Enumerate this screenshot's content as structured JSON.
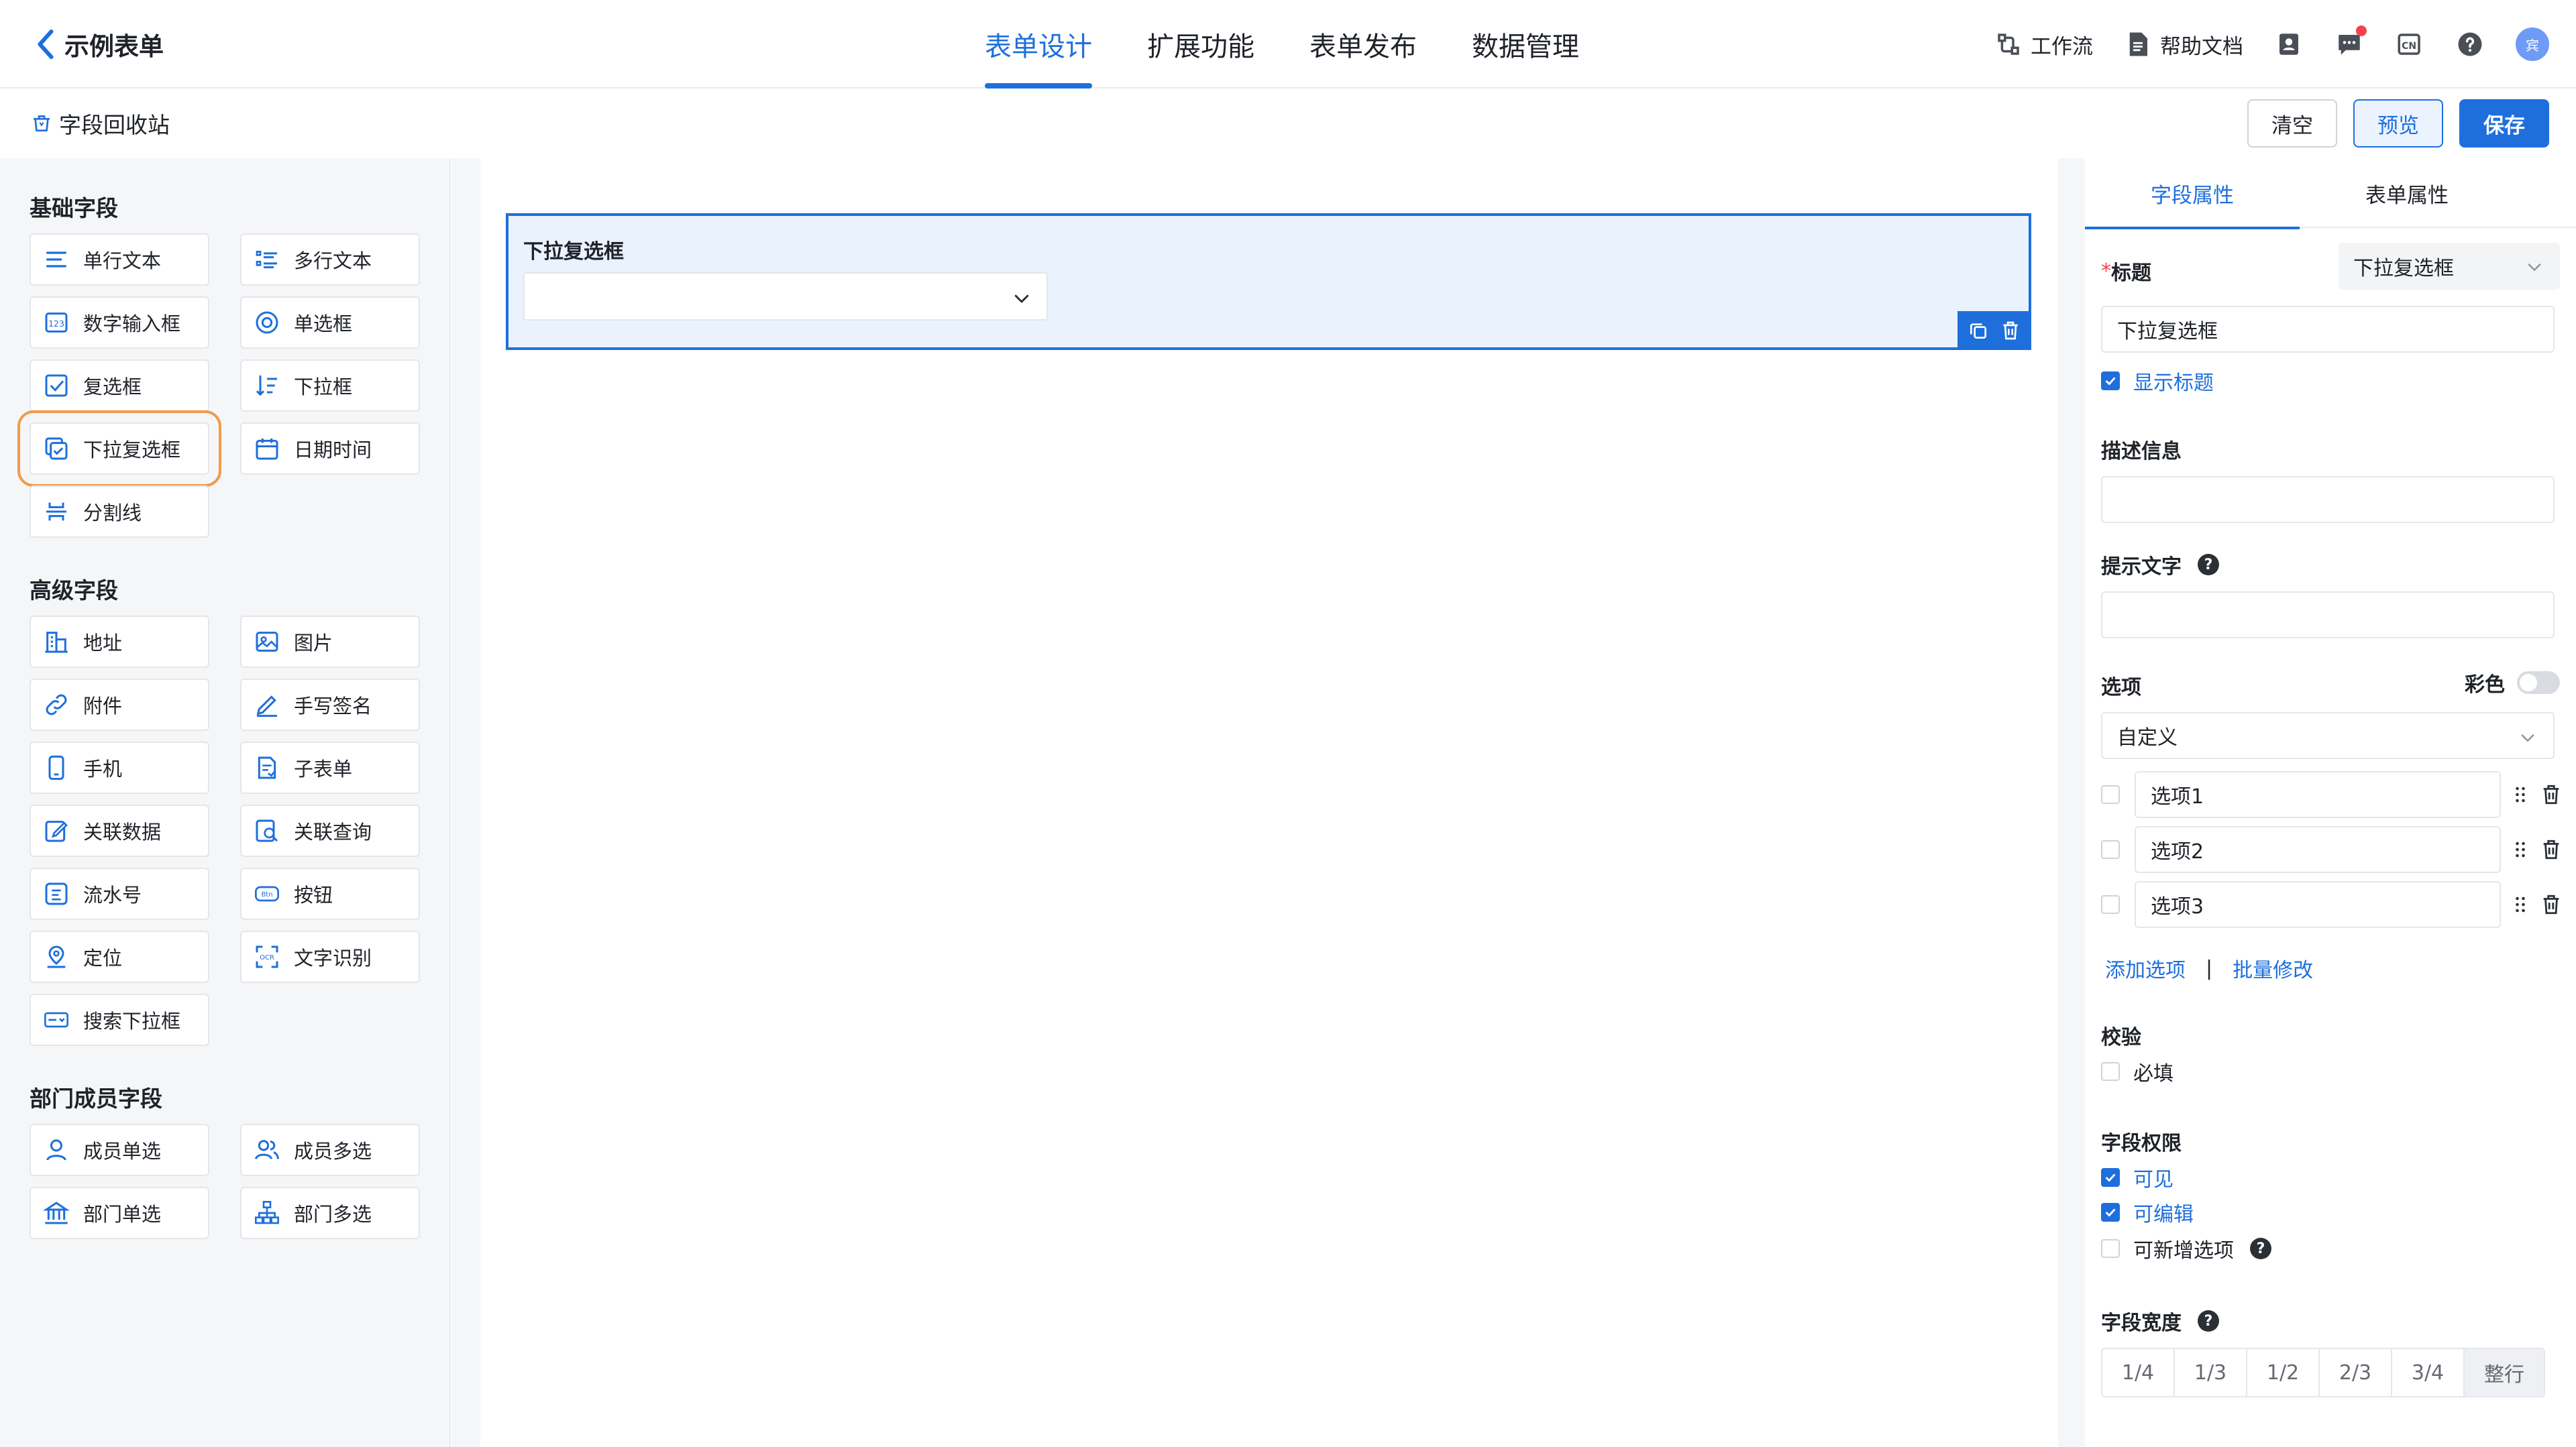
{
  "header": {
    "title": "示例表单",
    "tabs": [
      {
        "label": "表单设计",
        "active": true
      },
      {
        "label": "扩展功能",
        "active": false
      },
      {
        "label": "表单发布",
        "active": false
      },
      {
        "label": "数据管理",
        "active": false
      }
    ],
    "workflow_label": "工作流",
    "help_docs_label": "帮助文档",
    "avatar_text": "宾"
  },
  "toolbar": {
    "recycle_label": "字段回收站",
    "clear_label": "清空",
    "preview_label": "预览",
    "save_label": "保存"
  },
  "left_panel": {
    "groups": [
      {
        "title": "基础字段",
        "fields": [
          "单行文本",
          "多行文本",
          "数字输入框",
          "单选框",
          "复选框",
          "下拉框",
          "下拉复选框",
          "日期时间",
          "分割线"
        ]
      },
      {
        "title": "高级字段",
        "fields": [
          "地址",
          "图片",
          "附件",
          "手写签名",
          "手机",
          "子表单",
          "关联数据",
          "关联查询",
          "流水号",
          "按钮",
          "定位",
          "文字识别",
          "搜索下拉框"
        ]
      },
      {
        "title": "部门成员字段",
        "fields": [
          "成员单选",
          "成员多选",
          "部门单选",
          "部门多选"
        ]
      }
    ],
    "highlighted_field": "下拉复选框"
  },
  "canvas": {
    "field_label": "下拉复选框"
  },
  "right_panel": {
    "tabs": [
      {
        "label": "字段属性",
        "active": true
      },
      {
        "label": "表单属性",
        "active": false
      }
    ],
    "title_label": "标题",
    "title_required_mark": "*",
    "field_type_value": "下拉复选框",
    "title_value": "下拉复选框",
    "show_title_label": "显示标题",
    "show_title_checked": true,
    "description_label": "描述信息",
    "description_value": "",
    "placeholder_label": "提示文字",
    "placeholder_value": "",
    "options_label": "选项",
    "colorful_label": "彩色",
    "options_source": "自定义",
    "options": [
      "选项1",
      "选项2",
      "选项3"
    ],
    "add_option_label": "添加选项",
    "separator": "|",
    "batch_edit_label": "批量修改",
    "validation_label": "校验",
    "required_label": "必填",
    "permission_label": "字段权限",
    "permissions": [
      {
        "label": "可见",
        "checked": true
      },
      {
        "label": "可编辑",
        "checked": true
      },
      {
        "label": "可新增选项",
        "checked": false
      }
    ],
    "width_label": "字段宽度",
    "width_options": [
      "1/4",
      "1/3",
      "1/2",
      "2/3",
      "3/4",
      "整行"
    ],
    "width_selected": "整行"
  },
  "colors": {
    "accent": "#1e6fdc",
    "highlight_outline": "#f29a4a",
    "selected_card_bg": "#eaf2fe",
    "panel_bg": "#f5f6f8"
  }
}
